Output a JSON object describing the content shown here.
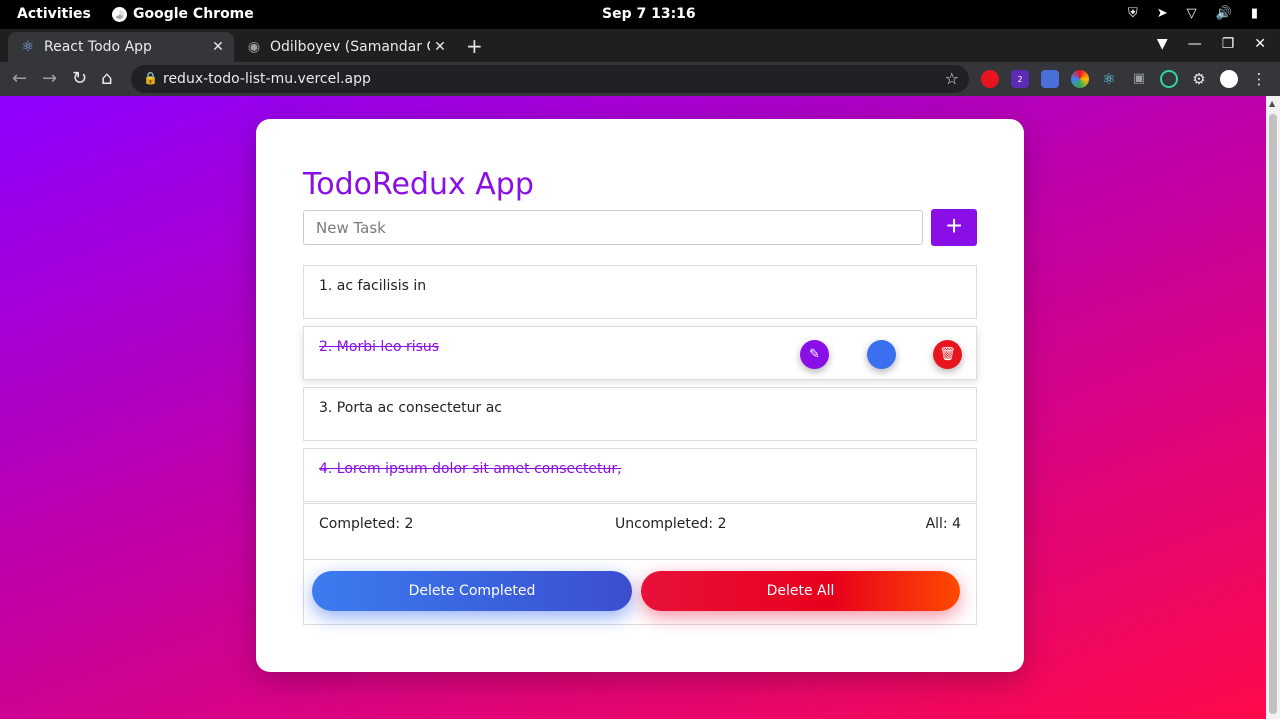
{
  "system": {
    "activities": "Activities",
    "app_name": "Google Chrome",
    "clock": "Sep 7  13:16"
  },
  "browser": {
    "tabs": [
      {
        "title": "React Todo App",
        "icon": "react-icon",
        "active": true
      },
      {
        "title": "Odilboyev (Samandar Od",
        "icon": "github-icon",
        "active": false
      }
    ],
    "url": "redux-todo-list-mu.vercel.app",
    "extension_badge": "2"
  },
  "app": {
    "title": "TodoRedux App",
    "input_placeholder": "New Task",
    "add_label": "+",
    "accent_color": "#8a0fe6",
    "todos": [
      {
        "text": "1. ac facilisis in",
        "completed": false
      },
      {
        "text": "2. Morbi leo risus",
        "completed": true
      },
      {
        "text": "3. Porta ac consectetur ac",
        "completed": false
      },
      {
        "text": "4. Lorem ipsum dolor sit amet consectetur,",
        "completed": true
      }
    ],
    "stats": {
      "completed": "Completed: 2",
      "uncompleted": "Uncompleted: 2",
      "all": "All: 4"
    },
    "buttons": {
      "delete_completed": "Delete Completed",
      "delete_all": "Delete All"
    }
  }
}
